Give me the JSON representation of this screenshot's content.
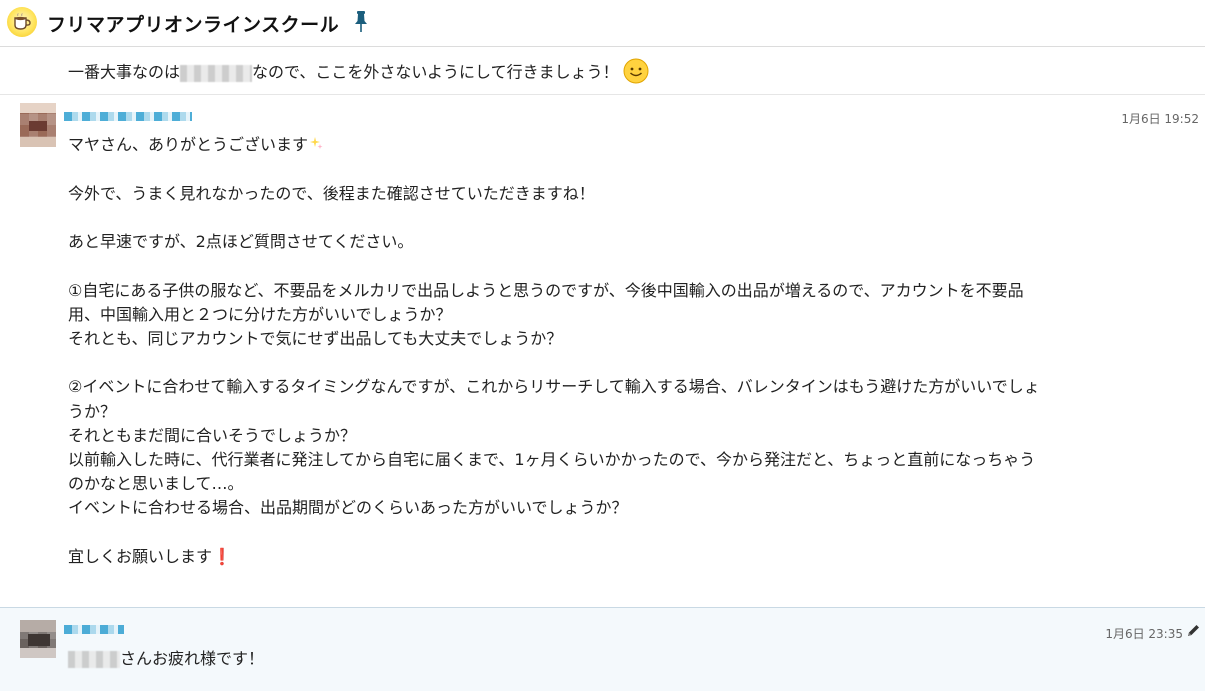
{
  "header": {
    "title": "フリマアプリオンラインスクール",
    "logo_icon": "coffee-cup-icon",
    "pin_icon": "pin-icon"
  },
  "previous_message": {
    "text_before": "一番大事なのは",
    "text_after": "なので、ここを外さないようにして行きましょう！",
    "emoji": "smile-emoji"
  },
  "messages": [
    {
      "time": "1月6日 19:52",
      "lines": [
        "マヤさん、ありがとうございます",
        "",
        "今外で、うまく見れなかったので、後程また確認させていただきますね！",
        "",
        "あと早速ですが、2点ほど質問させてください。",
        "",
        "①自宅にある子供の服など、不要品をメルカリで出品しようと思うのですが、今後中国輸入の出品が増えるので、アカウントを不要品",
        "用、中国輸入用と２つに分けた方がいいでしょうか？",
        "それとも、同じアカウントで気にせず出品しても大丈夫でしょうか？",
        "",
        "②イベントに合わせて輸入するタイミングなんですが、これからリサーチして輸入する場合、バレンタインはもう避けた方がいいでしょ",
        "うか？",
        "それともまだ間に合いそうでしょうか？",
        "以前輸入した時に、代行業者に発注してから自宅に届くまで、1ヶ月くらいかかったので、今から発注だと、ちょっと直前になっちゃう",
        "のかなと思いまして…。",
        "イベントに合わせる場合、出品期間がどのくらいあった方がいいでしょうか？",
        "",
        "宜しくお願いします❗"
      ]
    },
    {
      "time": "1月6日 23:35",
      "text": "さんお疲れ様です！",
      "edit_icon": "pencil-icon"
    }
  ]
}
